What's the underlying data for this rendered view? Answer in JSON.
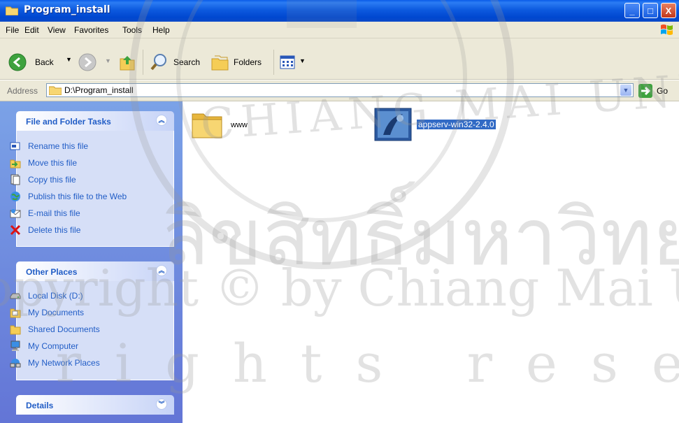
{
  "window": {
    "title": "Program_install",
    "minimize": "_",
    "maximize": "□",
    "close": "X"
  },
  "menu": [
    "File",
    "Edit",
    "View",
    "Favorites",
    "Tools",
    "Help"
  ],
  "toolbar": {
    "back": "Back",
    "search": "Search",
    "folders": "Folders"
  },
  "address": {
    "label": "Address",
    "path": "D:\\Program_install",
    "go": "Go"
  },
  "file_tasks": {
    "heading": "File and Folder Tasks",
    "items": [
      "Rename this file",
      "Move this file",
      "Copy this file",
      "Publish this file to the Web",
      "E-mail this file",
      "Delete this file"
    ]
  },
  "other_places": {
    "heading": "Other Places",
    "items": [
      "Local Disk (D:)",
      "My Documents",
      "Shared Documents",
      "My Computer",
      "My Network Places"
    ]
  },
  "details": {
    "heading": "Details"
  },
  "files": [
    {
      "name": "www",
      "type": "folder"
    },
    {
      "name": "appserv-win32-2.4.0",
      "type": "installer",
      "selected": true
    }
  ],
  "watermark": {
    "thai": "ลิขสิทธิ์มหาวิทยาลัยเชียงใหม่",
    "copyright": "Copyright © by Chiang Mai University",
    "rights": "All rights reserved",
    "seal": "CHIANG MAI UNIVERSITY"
  },
  "colors": {
    "accent": "#215dc6",
    "selection": "#316ac5",
    "titlebar": "#0a4ac8"
  }
}
